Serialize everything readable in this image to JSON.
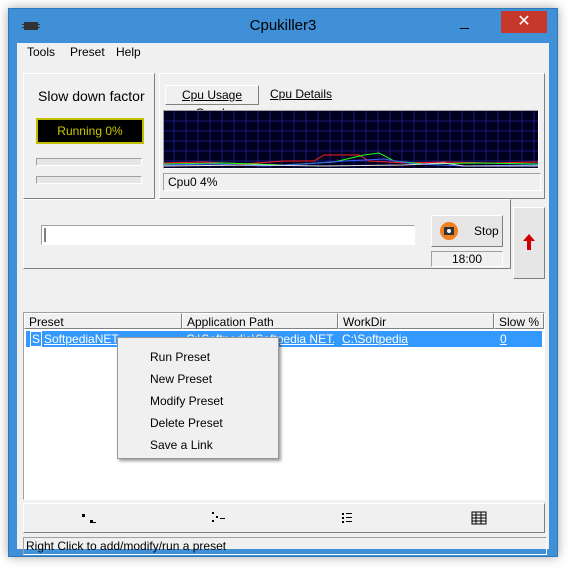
{
  "window": {
    "title": "Cpukiller3",
    "close_glyph": "✕"
  },
  "menu": {
    "items": [
      "Tools",
      "Preset",
      "Help"
    ]
  },
  "slowdown": {
    "label": "Slow down factor",
    "status": "Running 0%"
  },
  "tabs": [
    "Cpu Usage Graph",
    "Cpu Details"
  ],
  "cpu": {
    "label": "Cpu0 4%"
  },
  "controls": {
    "stop_label": "Stop",
    "timer": "18:00"
  },
  "list": {
    "columns": [
      "Preset",
      "Application Path",
      "WorkDir",
      "Slow %"
    ],
    "rows": [
      {
        "icon": "S",
        "preset": "SoftpediaNET",
        "path": "C:\\Softpedia\\Softpedia NET....",
        "workdir": "C:\\Softpedia",
        "slow": "0"
      }
    ]
  },
  "context_menu": {
    "items": [
      "Run Preset",
      "New Preset",
      "Modify Preset",
      "Delete Preset",
      "Save a Link"
    ]
  },
  "status": {
    "text": "Right Click to add/modify/run a preset"
  },
  "colors": {
    "title_bar": "#3f90d6",
    "close": "#c7382c",
    "selection": "#3399ff",
    "graph_bg": "#000020",
    "lcd_text": "#c8c800"
  }
}
